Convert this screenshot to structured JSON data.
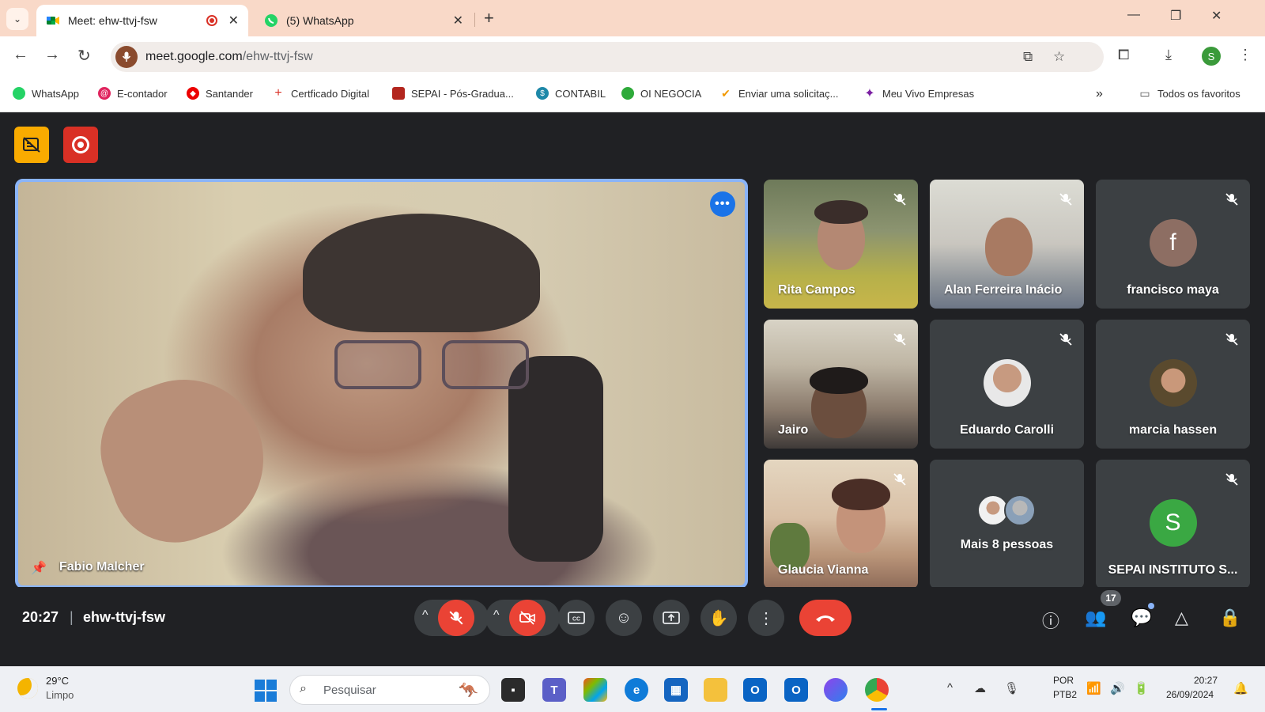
{
  "browser": {
    "tabs": [
      {
        "title": "Meet: ehw-ttvj-fsw",
        "close": "✕",
        "recording": true
      },
      {
        "title": "(5) WhatsApp",
        "close": "✕"
      }
    ],
    "new_tab": "+",
    "window_controls": {
      "minimize": "—",
      "restore": "❐",
      "close": "✕"
    },
    "url_host": "meet.google.com",
    "url_path": "/ehw-ttvj-fsw",
    "bookmarks": [
      {
        "label": "WhatsApp",
        "icon": "whatsapp-icon",
        "color": "#25d366"
      },
      {
        "label": "E-contador",
        "icon": "e-contador-icon",
        "color": "#e0245e"
      },
      {
        "label": "Santander",
        "icon": "santander-icon",
        "color": "#ec0000"
      },
      {
        "label": "Certficado Digital",
        "icon": "plus-icon",
        "color": "#d93025"
      },
      {
        "label": "SEPAI - Pós-Gradua...",
        "icon": "sepai-icon",
        "color": "#b3261e"
      },
      {
        "label": "CONTABIL",
        "icon": "contabil-icon",
        "color": "#1e88a8"
      },
      {
        "label": "OI NEGOCIA",
        "icon": "oi-icon",
        "color": "#2eaa3a"
      },
      {
        "label": "Enviar uma solicitaç...",
        "icon": "enviar-icon",
        "color": "#f29900"
      },
      {
        "label": "Meu Vivo Empresas",
        "icon": "vivo-icon",
        "color": "#7b1fa2"
      }
    ],
    "bookmarks_overflow": "»",
    "all_bookmarks": "Todos os favoritos",
    "profile_initial": "S"
  },
  "meet": {
    "main_speaker": "Fabio Malcher",
    "participants": [
      {
        "name": "Rita Campos",
        "type": "video",
        "muted": true
      },
      {
        "name": "Alan Ferreira Inácio",
        "type": "video",
        "muted": true
      },
      {
        "name": "francisco maya",
        "type": "avatar",
        "initial": "f",
        "avatar_color": "#8d6e63",
        "muted": true
      },
      {
        "name": "Jairo",
        "type": "video",
        "muted": true
      },
      {
        "name": "Eduardo Carolli",
        "type": "photo",
        "muted": true
      },
      {
        "name": "marcia hassen",
        "type": "photo",
        "muted": true
      },
      {
        "name": "Glaucia Vianna",
        "type": "video",
        "muted": true
      },
      {
        "name": "Mais 8 pessoas",
        "type": "group"
      },
      {
        "name": "SEPAI INSTITUTO S...",
        "type": "avatar",
        "initial": "S",
        "avatar_color": "#3aa843",
        "muted": true
      }
    ],
    "time": "20:27",
    "meeting_code": "ehw-ttvj-fsw",
    "people_count": "17",
    "colors": {
      "accent": "#8ab4f8",
      "danger": "#ea4335",
      "panel": "#3c4043"
    }
  },
  "taskbar": {
    "temperature": "29°C",
    "condition": "Limpo",
    "search_placeholder": "Pesquisar",
    "lang": "POR",
    "layout": "PTB2",
    "time": "20:27",
    "date": "26/09/2024"
  }
}
